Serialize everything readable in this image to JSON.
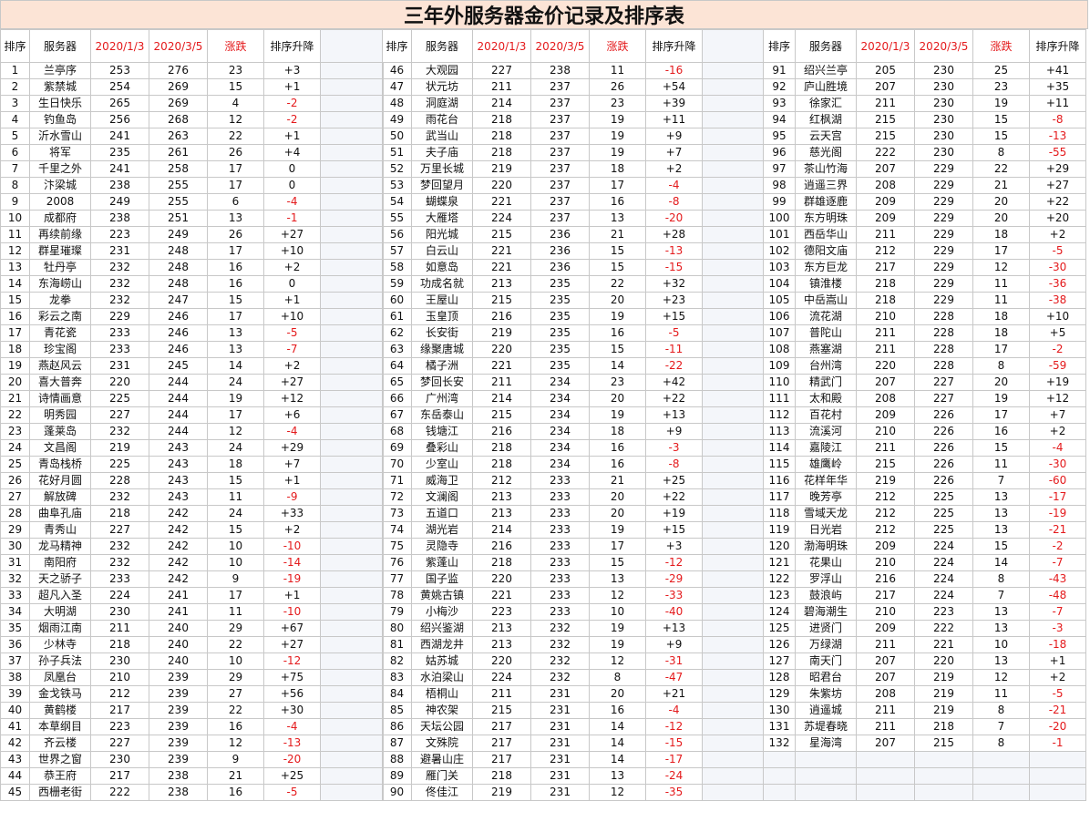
{
  "title": "三年外服务器金价记录及排序表",
  "headers": {
    "rank": "排序",
    "server": "服务器",
    "date1": "2020/1/3",
    "date2": "2020/3/5",
    "change": "涨跌",
    "rank_change": "排序升降"
  },
  "rows": [
    [
      "1",
      "兰亭序",
      "253",
      "276",
      "23",
      "+3"
    ],
    [
      "2",
      "紫禁城",
      "254",
      "269",
      "15",
      "+1"
    ],
    [
      "3",
      "生日快乐",
      "265",
      "269",
      "4",
      "-2"
    ],
    [
      "4",
      "钓鱼岛",
      "256",
      "268",
      "12",
      "-2"
    ],
    [
      "5",
      "沂水雪山",
      "241",
      "263",
      "22",
      "+1"
    ],
    [
      "6",
      "将军",
      "235",
      "261",
      "26",
      "+4"
    ],
    [
      "7",
      "千里之外",
      "241",
      "258",
      "17",
      "0"
    ],
    [
      "8",
      "汴梁城",
      "238",
      "255",
      "17",
      "0"
    ],
    [
      "9",
      "2008",
      "249",
      "255",
      "6",
      "-4"
    ],
    [
      "10",
      "成都府",
      "238",
      "251",
      "13",
      "-1"
    ],
    [
      "11",
      "再续前缘",
      "223",
      "249",
      "26",
      "+27"
    ],
    [
      "12",
      "群星璀璨",
      "231",
      "248",
      "17",
      "+10"
    ],
    [
      "13",
      "牡丹亭",
      "232",
      "248",
      "16",
      "+2"
    ],
    [
      "14",
      "东海崂山",
      "232",
      "248",
      "16",
      "0"
    ],
    [
      "15",
      "龙拳",
      "232",
      "247",
      "15",
      "+1"
    ],
    [
      "16",
      "彩云之南",
      "229",
      "246",
      "17",
      "+10"
    ],
    [
      "17",
      "青花瓷",
      "233",
      "246",
      "13",
      "-5"
    ],
    [
      "18",
      "珍宝阁",
      "233",
      "246",
      "13",
      "-7"
    ],
    [
      "19",
      "燕赵风云",
      "231",
      "245",
      "14",
      "+2"
    ],
    [
      "20",
      "喜大普奔",
      "220",
      "244",
      "24",
      "+27"
    ],
    [
      "21",
      "诗情画意",
      "225",
      "244",
      "19",
      "+12"
    ],
    [
      "22",
      "明秀园",
      "227",
      "244",
      "17",
      "+6"
    ],
    [
      "23",
      "蓬莱岛",
      "232",
      "244",
      "12",
      "-4"
    ],
    [
      "24",
      "文昌阁",
      "219",
      "243",
      "24",
      "+29"
    ],
    [
      "25",
      "青岛栈桥",
      "225",
      "243",
      "18",
      "+7"
    ],
    [
      "26",
      "花好月圆",
      "228",
      "243",
      "15",
      "+1"
    ],
    [
      "27",
      "解放碑",
      "232",
      "243",
      "11",
      "-9"
    ],
    [
      "28",
      "曲阜孔庙",
      "218",
      "242",
      "24",
      "+33"
    ],
    [
      "29",
      "青秀山",
      "227",
      "242",
      "15",
      "+2"
    ],
    [
      "30",
      "龙马精神",
      "232",
      "242",
      "10",
      "-10"
    ],
    [
      "31",
      "南阳府",
      "232",
      "242",
      "10",
      "-14"
    ],
    [
      "32",
      "天之骄子",
      "233",
      "242",
      "9",
      "-19"
    ],
    [
      "33",
      "超凡入圣",
      "224",
      "241",
      "17",
      "+1"
    ],
    [
      "34",
      "大明湖",
      "230",
      "241",
      "11",
      "-10"
    ],
    [
      "35",
      "烟雨江南",
      "211",
      "240",
      "29",
      "+67"
    ],
    [
      "36",
      "少林寺",
      "218",
      "240",
      "22",
      "+27"
    ],
    [
      "37",
      "孙子兵法",
      "230",
      "240",
      "10",
      "-12"
    ],
    [
      "38",
      "凤凰台",
      "210",
      "239",
      "29",
      "+75"
    ],
    [
      "39",
      "金戈铁马",
      "212",
      "239",
      "27",
      "+56"
    ],
    [
      "40",
      "黄鹤楼",
      "217",
      "239",
      "22",
      "+30"
    ],
    [
      "41",
      "本草纲目",
      "223",
      "239",
      "16",
      "-4"
    ],
    [
      "42",
      "齐云楼",
      "227",
      "239",
      "12",
      "-13"
    ],
    [
      "43",
      "世界之窗",
      "230",
      "239",
      "9",
      "-20"
    ],
    [
      "44",
      "恭王府",
      "217",
      "238",
      "21",
      "+25"
    ],
    [
      "45",
      "西栅老街",
      "222",
      "238",
      "16",
      "-5"
    ],
    [
      "46",
      "大观园",
      "227",
      "238",
      "11",
      "-16"
    ],
    [
      "47",
      "状元坊",
      "211",
      "237",
      "26",
      "+54"
    ],
    [
      "48",
      "洞庭湖",
      "214",
      "237",
      "23",
      "+39"
    ],
    [
      "49",
      "雨花台",
      "218",
      "237",
      "19",
      "+11"
    ],
    [
      "50",
      "武当山",
      "218",
      "237",
      "19",
      "+9"
    ],
    [
      "51",
      "夫子庙",
      "218",
      "237",
      "19",
      "+7"
    ],
    [
      "52",
      "万里长城",
      "219",
      "237",
      "18",
      "+2"
    ],
    [
      "53",
      "梦回望月",
      "220",
      "237",
      "17",
      "-4"
    ],
    [
      "54",
      "蝴蝶泉",
      "221",
      "237",
      "16",
      "-8"
    ],
    [
      "55",
      "大雁塔",
      "224",
      "237",
      "13",
      "-20"
    ],
    [
      "56",
      "阳光城",
      "215",
      "236",
      "21",
      "+28"
    ],
    [
      "57",
      "白云山",
      "221",
      "236",
      "15",
      "-13"
    ],
    [
      "58",
      "如意岛",
      "221",
      "236",
      "15",
      "-15"
    ],
    [
      "59",
      "功成名就",
      "213",
      "235",
      "22",
      "+32"
    ],
    [
      "60",
      "王屋山",
      "215",
      "235",
      "20",
      "+23"
    ],
    [
      "61",
      "玉皇顶",
      "216",
      "235",
      "19",
      "+15"
    ],
    [
      "62",
      "长安街",
      "219",
      "235",
      "16",
      "-5"
    ],
    [
      "63",
      "缘聚唐城",
      "220",
      "235",
      "15",
      "-11"
    ],
    [
      "64",
      "橘子洲",
      "221",
      "235",
      "14",
      "-22"
    ],
    [
      "65",
      "梦回长安",
      "211",
      "234",
      "23",
      "+42"
    ],
    [
      "66",
      "广州湾",
      "214",
      "234",
      "20",
      "+22"
    ],
    [
      "67",
      "东岳泰山",
      "215",
      "234",
      "19",
      "+13"
    ],
    [
      "68",
      "钱塘江",
      "216",
      "234",
      "18",
      "+9"
    ],
    [
      "69",
      "叠彩山",
      "218",
      "234",
      "16",
      "-3"
    ],
    [
      "70",
      "少室山",
      "218",
      "234",
      "16",
      "-8"
    ],
    [
      "71",
      "威海卫",
      "212",
      "233",
      "21",
      "+25"
    ],
    [
      "72",
      "文澜阁",
      "213",
      "233",
      "20",
      "+22"
    ],
    [
      "73",
      "五道口",
      "213",
      "233",
      "20",
      "+19"
    ],
    [
      "74",
      "湖光岩",
      "214",
      "233",
      "19",
      "+15"
    ],
    [
      "75",
      "灵隐寺",
      "216",
      "233",
      "17",
      "+3"
    ],
    [
      "76",
      "紫蓬山",
      "218",
      "233",
      "15",
      "-12"
    ],
    [
      "77",
      "国子监",
      "220",
      "233",
      "13",
      "-29"
    ],
    [
      "78",
      "黄姚古镇",
      "221",
      "233",
      "12",
      "-33"
    ],
    [
      "79",
      "小梅沙",
      "223",
      "233",
      "10",
      "-40"
    ],
    [
      "80",
      "绍兴鉴湖",
      "213",
      "232",
      "19",
      "+13"
    ],
    [
      "81",
      "西湖龙井",
      "213",
      "232",
      "19",
      "+9"
    ],
    [
      "82",
      "姑苏城",
      "220",
      "232",
      "12",
      "-31"
    ],
    [
      "83",
      "水泊梁山",
      "224",
      "232",
      "8",
      "-47"
    ],
    [
      "84",
      "梧桐山",
      "211",
      "231",
      "20",
      "+21"
    ],
    [
      "85",
      "神农架",
      "215",
      "231",
      "16",
      "-4"
    ],
    [
      "86",
      "天坛公园",
      "217",
      "231",
      "14",
      "-12"
    ],
    [
      "87",
      "文殊院",
      "217",
      "231",
      "14",
      "-15"
    ],
    [
      "88",
      "避暑山庄",
      "217",
      "231",
      "14",
      "-17"
    ],
    [
      "89",
      "雁门关",
      "218",
      "231",
      "13",
      "-24"
    ],
    [
      "90",
      "佟佳江",
      "219",
      "231",
      "12",
      "-35"
    ],
    [
      "91",
      "绍兴兰亭",
      "205",
      "230",
      "25",
      "+41"
    ],
    [
      "92",
      "庐山胜境",
      "207",
      "230",
      "23",
      "+35"
    ],
    [
      "93",
      "徐家汇",
      "211",
      "230",
      "19",
      "+11"
    ],
    [
      "94",
      "红枫湖",
      "215",
      "230",
      "15",
      "-8"
    ],
    [
      "95",
      "云天宫",
      "215",
      "230",
      "15",
      "-13"
    ],
    [
      "96",
      "慈光阁",
      "222",
      "230",
      "8",
      "-55"
    ],
    [
      "97",
      "茶山竹海",
      "207",
      "229",
      "22",
      "+29"
    ],
    [
      "98",
      "逍遥三界",
      "208",
      "229",
      "21",
      "+27"
    ],
    [
      "99",
      "群雄逐鹿",
      "209",
      "229",
      "20",
      "+22"
    ],
    [
      "100",
      "东方明珠",
      "209",
      "229",
      "20",
      "+20"
    ],
    [
      "101",
      "西岳华山",
      "211",
      "229",
      "18",
      "+2"
    ],
    [
      "102",
      "德阳文庙",
      "212",
      "229",
      "17",
      "-5"
    ],
    [
      "103",
      "东方巨龙",
      "217",
      "229",
      "12",
      "-30"
    ],
    [
      "104",
      "镇淮楼",
      "218",
      "229",
      "11",
      "-36"
    ],
    [
      "105",
      "中岳嵩山",
      "218",
      "229",
      "11",
      "-38"
    ],
    [
      "106",
      "流花湖",
      "210",
      "228",
      "18",
      "+10"
    ],
    [
      "107",
      "普陀山",
      "211",
      "228",
      "18",
      "+5"
    ],
    [
      "108",
      "燕塞湖",
      "211",
      "228",
      "17",
      "-2"
    ],
    [
      "109",
      "台州湾",
      "220",
      "228",
      "8",
      "-59"
    ],
    [
      "110",
      "精武门",
      "207",
      "227",
      "20",
      "+19"
    ],
    [
      "111",
      "太和殿",
      "208",
      "227",
      "19",
      "+12"
    ],
    [
      "112",
      "百花村",
      "209",
      "226",
      "17",
      "+7"
    ],
    [
      "113",
      "流溪河",
      "210",
      "226",
      "16",
      "+2"
    ],
    [
      "114",
      "嘉陵江",
      "211",
      "226",
      "15",
      "-4"
    ],
    [
      "115",
      "雄鹰岭",
      "215",
      "226",
      "11",
      "-30"
    ],
    [
      "116",
      "花样年华",
      "219",
      "226",
      "7",
      "-60"
    ],
    [
      "117",
      "晚芳亭",
      "212",
      "225",
      "13",
      "-17"
    ],
    [
      "118",
      "雪域天龙",
      "212",
      "225",
      "13",
      "-19"
    ],
    [
      "119",
      "日光岩",
      "212",
      "225",
      "13",
      "-21"
    ],
    [
      "120",
      "渤海明珠",
      "209",
      "224",
      "15",
      "-2"
    ],
    [
      "121",
      "花果山",
      "210",
      "224",
      "14",
      "-7"
    ],
    [
      "122",
      "罗浮山",
      "216",
      "224",
      "8",
      "-43"
    ],
    [
      "123",
      "鼓浪屿",
      "217",
      "224",
      "7",
      "-48"
    ],
    [
      "124",
      "碧海潮生",
      "210",
      "223",
      "13",
      "-7"
    ],
    [
      "125",
      "进贤门",
      "209",
      "222",
      "13",
      "-3"
    ],
    [
      "126",
      "万绿湖",
      "211",
      "221",
      "10",
      "-18"
    ],
    [
      "127",
      "南天门",
      "207",
      "220",
      "13",
      "+1"
    ],
    [
      "128",
      "昭君台",
      "207",
      "219",
      "12",
      "+2"
    ],
    [
      "129",
      "朱紫坊",
      "208",
      "219",
      "11",
      "-5"
    ],
    [
      "130",
      "逍遥城",
      "211",
      "219",
      "8",
      "-21"
    ],
    [
      "131",
      "苏堤春晓",
      "211",
      "218",
      "7",
      "-20"
    ],
    [
      "132",
      "星海湾",
      "207",
      "215",
      "8",
      "-1"
    ]
  ]
}
